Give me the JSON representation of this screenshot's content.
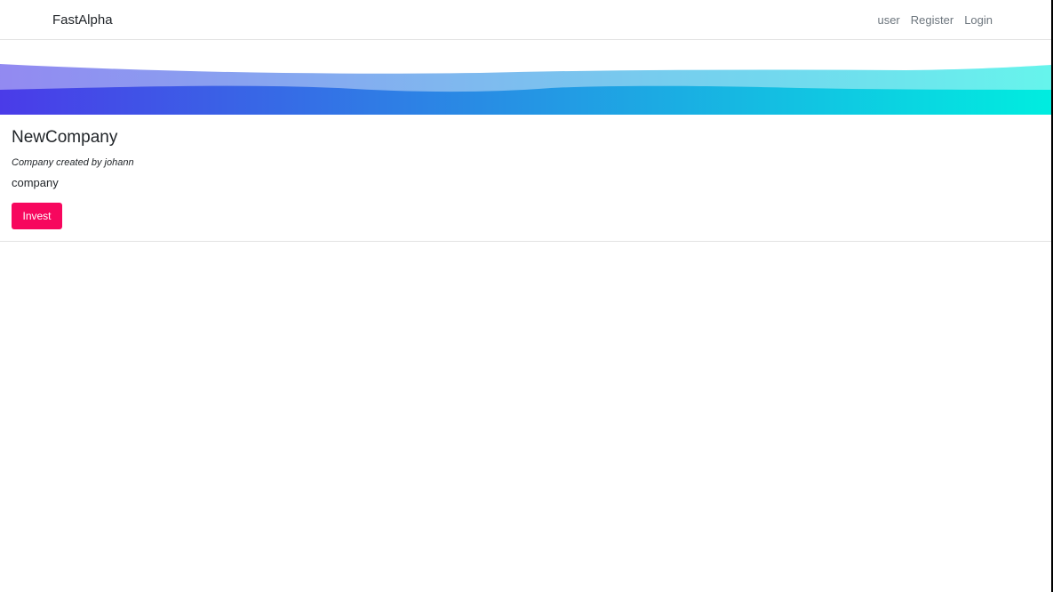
{
  "navbar": {
    "brand": "FastAlpha",
    "links": [
      {
        "label": "user"
      },
      {
        "label": "Register"
      },
      {
        "label": "Login"
      }
    ]
  },
  "banner": {
    "gradient_start": "#4a3be8",
    "gradient_end": "#00ede0"
  },
  "company": {
    "name": "NewCompany",
    "subtitle": "Company created by johann",
    "description": "company",
    "invest_label": "Invest",
    "invest_color": "#f7075e"
  }
}
